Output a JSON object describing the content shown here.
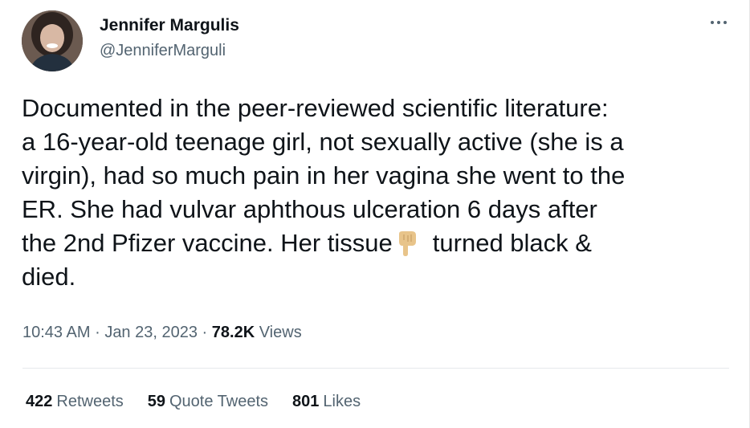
{
  "author": {
    "name": "Jennifer Margulis",
    "handle": "@JenniferMarguli"
  },
  "tweet": {
    "line1": "Documented in the peer-reviewed scientific literature:",
    "line2": "a 16-year-old teenage girl, not sexually active (she is a",
    "line3": "virgin), had so much pain in her vagina she went to the",
    "line4": "ER. She had vulvar aphthous ulceration 6 days after",
    "line5a": "the 2nd Pfizer vaccine. Her tissue",
    "emoji": "backhand-index-pointing-down-icon",
    "line5b": "turned black &",
    "line6": "died."
  },
  "meta": {
    "time": "10:43 AM",
    "date": "Jan 23, 2023",
    "separator": "·",
    "views_count": "78.2K",
    "views_label": "Views"
  },
  "stats": {
    "retweets_count": "422",
    "retweets_label": "Retweets",
    "quotes_count": "59",
    "quotes_label": "Quote Tweets",
    "likes_count": "801",
    "likes_label": "Likes"
  },
  "colors": {
    "text": "#0f1419",
    "secondary": "#536471",
    "divider": "#e6e9ec"
  }
}
